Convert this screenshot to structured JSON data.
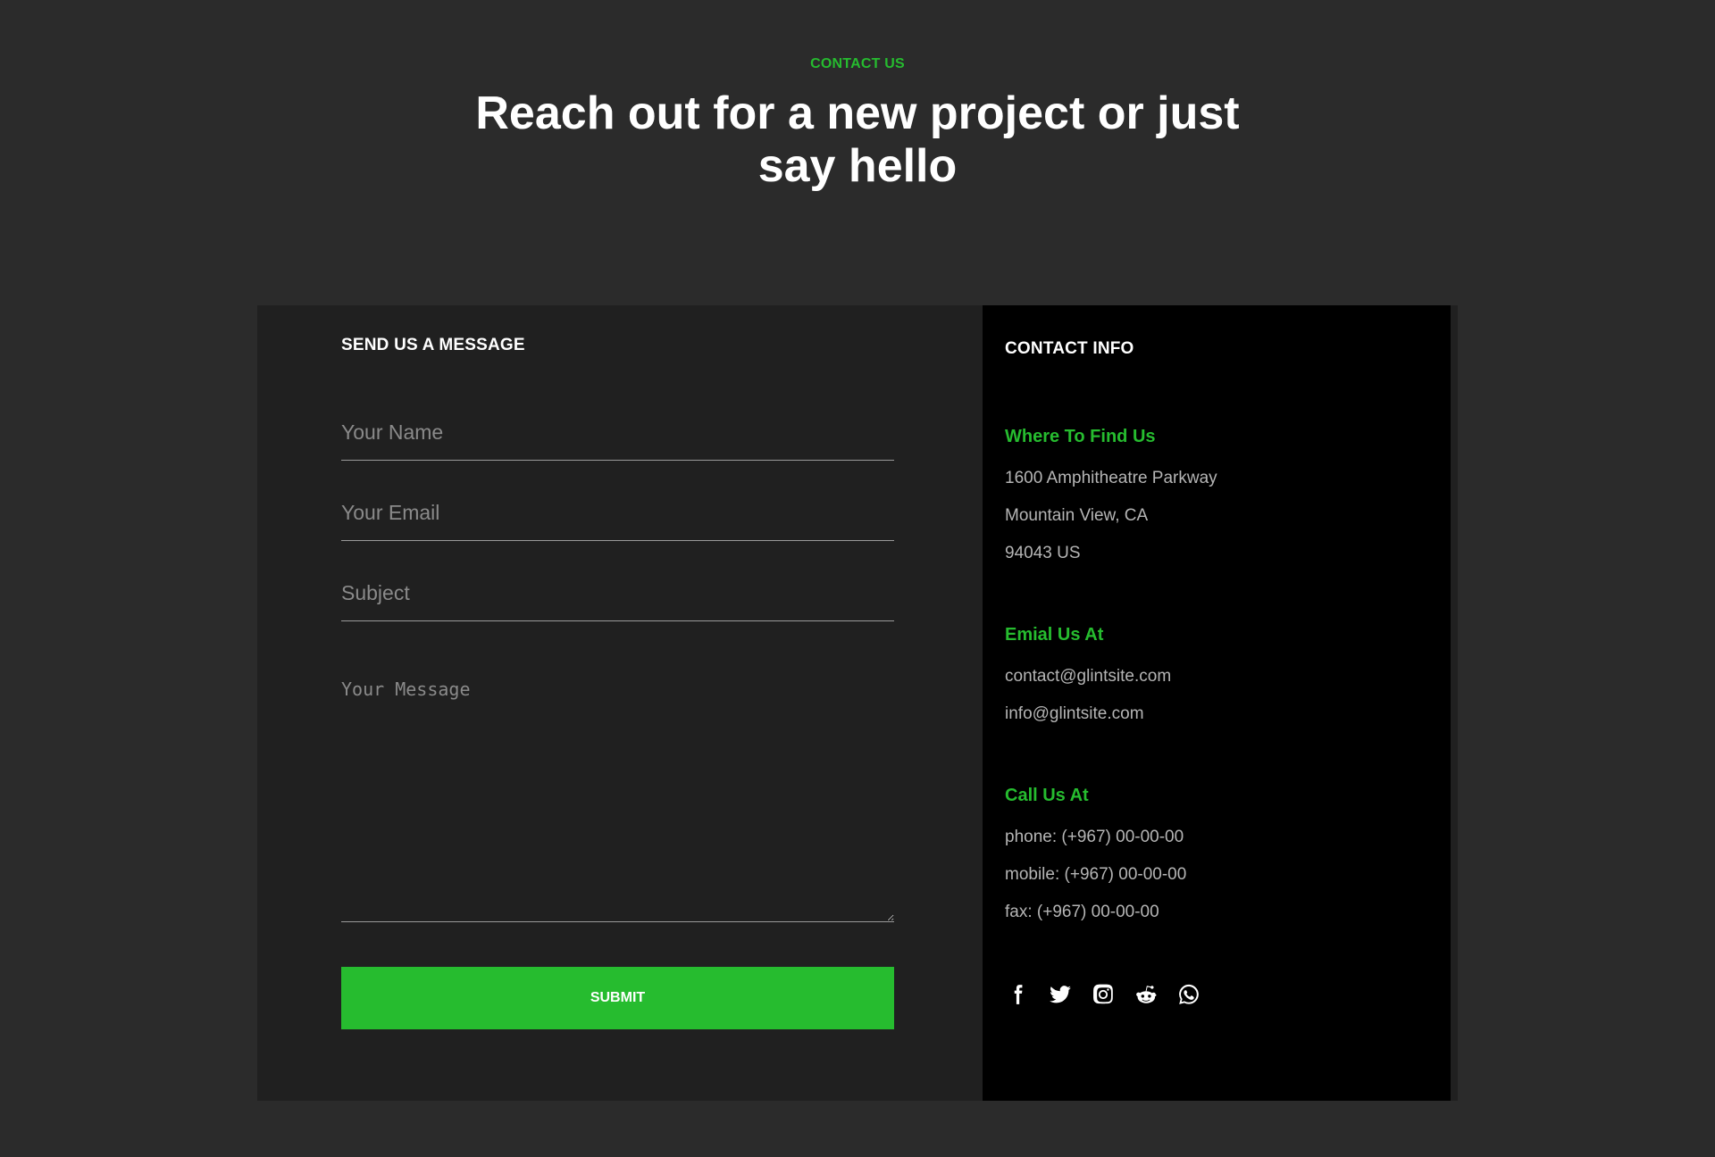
{
  "header": {
    "eyebrow": "CONTACT US",
    "headline": "Reach out for a new project or just say hello"
  },
  "form": {
    "title": "SEND US A MESSAGE",
    "name_placeholder": "Your Name",
    "email_placeholder": "Your Email",
    "subject_placeholder": "Subject",
    "message_placeholder": "Your Message",
    "submit_label": "SUBMIT"
  },
  "info": {
    "title": "CONTACT INFO",
    "address": {
      "heading": "Where To Find Us",
      "lines": [
        "1600 Amphitheatre Parkway",
        "Mountain View, CA",
        "94043 US"
      ]
    },
    "email": {
      "heading": "Emial Us At",
      "lines": [
        "contact@glintsite.com",
        "info@glintsite.com"
      ]
    },
    "call": {
      "heading": "Call Us At",
      "lines": [
        "phone: (+967) 00-00-00",
        "mobile: (+967) 00-00-00",
        "fax: (+967) 00-00-00"
      ]
    },
    "social_icons": [
      "facebook-icon",
      "twitter-icon",
      "instagram-icon",
      "reddit-icon",
      "whatsapp-icon"
    ]
  },
  "colors": {
    "accent": "#26bc2f",
    "page_bg": "#2b2b2b",
    "form_bg": "#202020",
    "info_bg": "#000000"
  }
}
